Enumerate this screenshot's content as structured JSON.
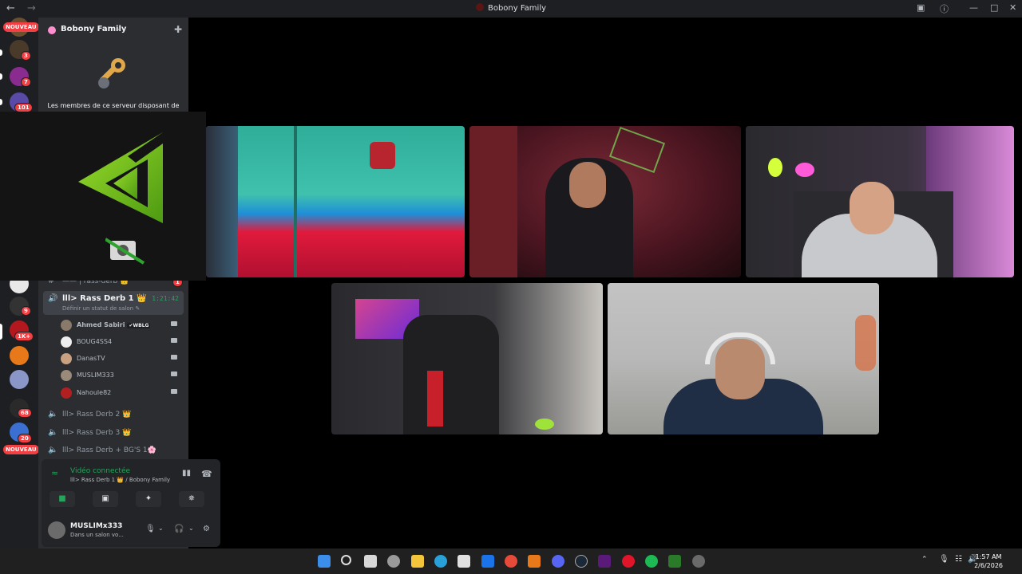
{
  "window": {
    "title": "Bobony Family"
  },
  "guilds": {
    "top_badge": "NOUVEAU",
    "bottom_badge": "NOUVEAU",
    "items": [
      {
        "badge": "3"
      },
      {
        "badge": "7"
      },
      {
        "badge": "101"
      },
      {
        "badge": "9"
      },
      {
        "badge": "1K+"
      },
      {
        "badge": "68"
      },
      {
        "badge": "20"
      }
    ]
  },
  "server": {
    "name": "Bobony Family",
    "boost_text": "Les membres de ce serveur disposant de"
  },
  "channels": {
    "partial_channel": "—— | rass-derb 👑",
    "partial_badge": "1",
    "active": {
      "name": "lll> Rass Derb 1 👑",
      "status": "Définir un statut de salon ✎",
      "timer": "1:21:42"
    },
    "voice_users": [
      {
        "name": "Ahmed Sabiri",
        "tag": "✔WBLG"
      },
      {
        "name": "BOUG4SS4",
        "tag": ""
      },
      {
        "name": "DanasTV",
        "tag": ""
      },
      {
        "name": "MUSLIM333",
        "tag": ""
      },
      {
        "name": "Nahoule82",
        "tag": ""
      }
    ],
    "other_voice": [
      {
        "name": "lll> Rass Derb 2 👑"
      },
      {
        "name": "lll> Rass Derb 3 👑"
      },
      {
        "name": "lll> Rass Derb + BG'S 1🌸"
      }
    ]
  },
  "voice_connection": {
    "status": "Vidéo connectée",
    "location": "lll> Rass Derb 1 👑 / Bobony Family"
  },
  "user": {
    "name": "MUSLIMx333",
    "status": "Dans un salon vo..."
  },
  "taskbar": {
    "time": "1:57 AM",
    "date": "2/6/2026"
  },
  "colors": {
    "accent_green": "#23a55a",
    "badge_red": "#f23f43",
    "sidebar_bg": "#2b2d31",
    "rail_bg": "#1e1f22"
  }
}
